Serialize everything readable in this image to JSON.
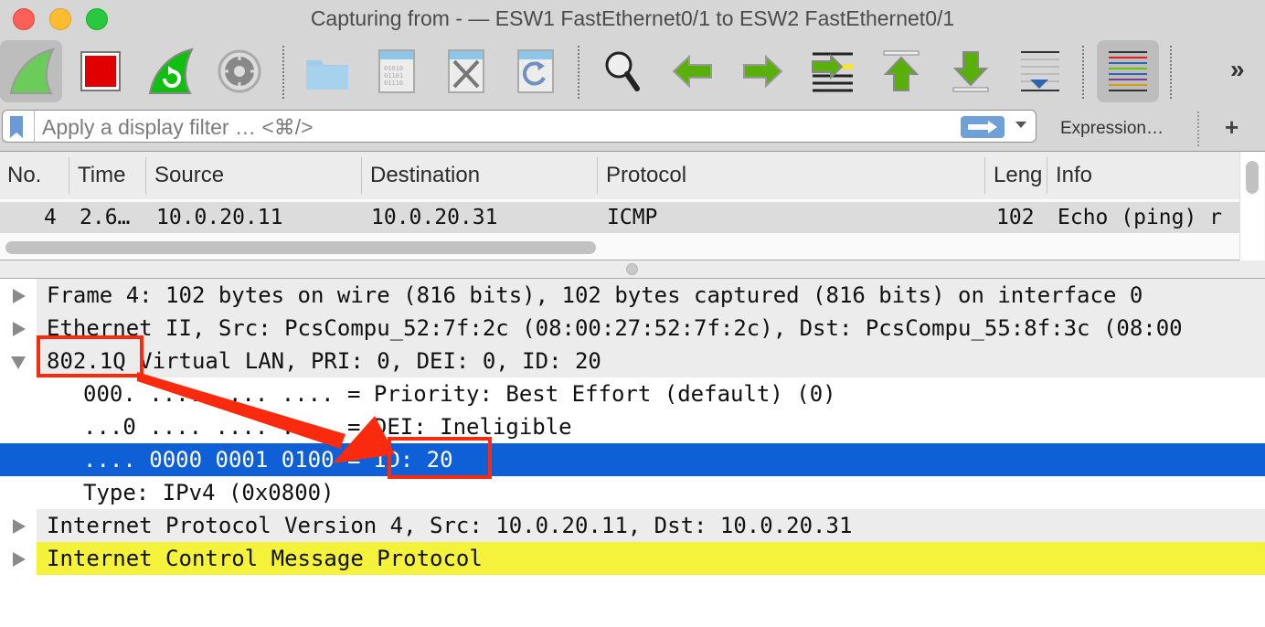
{
  "window": {
    "title": "Capturing from - — ESW1 FastEthernet0/1 to ESW2 FastEthernet0/1"
  },
  "toolbar": {
    "buttons": [
      {
        "name": "start-capture",
        "icon": "shark-fin-icon",
        "active": true
      },
      {
        "name": "stop-capture",
        "icon": "stop-square-icon"
      },
      {
        "name": "restart-capture",
        "icon": "shark-fin-restart-icon"
      },
      {
        "name": "capture-options",
        "icon": "gear-icon"
      },
      {
        "name": "open-file",
        "icon": "folder-icon"
      },
      {
        "name": "save-file",
        "icon": "binary-file-icon"
      },
      {
        "name": "close-file",
        "icon": "binary-file-close-icon"
      },
      {
        "name": "reload-file",
        "icon": "binary-file-reload-icon"
      },
      {
        "name": "find-packet",
        "icon": "magnifier-icon"
      },
      {
        "name": "go-back",
        "icon": "arrow-left-icon"
      },
      {
        "name": "go-forward",
        "icon": "arrow-right-icon"
      },
      {
        "name": "go-to-packet",
        "icon": "jump-to-packet-icon"
      },
      {
        "name": "go-first",
        "icon": "arrow-top-icon"
      },
      {
        "name": "go-last",
        "icon": "arrow-bottom-icon"
      },
      {
        "name": "auto-scroll",
        "icon": "autoscroll-icon"
      },
      {
        "name": "colorize",
        "icon": "colorize-lines-icon",
        "active": true
      }
    ],
    "overflow_label": "»"
  },
  "filter": {
    "placeholder": "Apply a display filter … <⌘/>",
    "expression_label": "Expression…",
    "add_label": "+"
  },
  "packet_list": {
    "columns": [
      "No.",
      "Time",
      "Source",
      "Destination",
      "Protocol",
      "Leng",
      "Info"
    ],
    "rows": [
      {
        "no": "4",
        "time": "2.6…",
        "source": "10.0.20.11",
        "destination": "10.0.20.31",
        "protocol": "ICMP",
        "length": "102",
        "info": "Echo (ping) r"
      }
    ]
  },
  "details": {
    "rows": [
      {
        "text": "Frame 4: 102 bytes on wire (816 bits), 102 bytes captured (816 bits) on interface 0",
        "expandable": true,
        "expanded": false
      },
      {
        "text": "Ethernet II, Src: PcsCompu_52:7f:2c (08:00:27:52:7f:2c), Dst: PcsCompu_55:8f:3c (08:00",
        "expandable": true,
        "expanded": false
      },
      {
        "text": "802.1Q Virtual LAN, PRI: 0, DEI: 0, ID: 20",
        "expandable": true,
        "expanded": true
      },
      {
        "text": "000. .... .... .... = Priority: Best Effort (default) (0)",
        "expandable": false
      },
      {
        "text": "...0 .... .... .... = DEI: Ineligible",
        "expandable": false
      },
      {
        "text": ".... 0000 0001 0100 = ID: 20",
        "expandable": false,
        "selected": true
      },
      {
        "text": "Type: IPv4 (0x0800)",
        "expandable": false
      },
      {
        "text": "Internet Protocol Version 4, Src: 10.0.20.11, Dst: 10.0.20.31",
        "expandable": true,
        "expanded": false
      },
      {
        "text": "Internet Control Message Protocol",
        "expandable": true,
        "expanded": false,
        "highlight": true
      }
    ]
  },
  "annotations": {
    "box_1_label": "802.1Q",
    "box_2_label": "ID: 20",
    "color": "#fa2a0f"
  },
  "colors": {
    "selected_row": "#0f5fd7",
    "icmp_highlight": "#f5f23c",
    "header_row": "#ececec"
  }
}
